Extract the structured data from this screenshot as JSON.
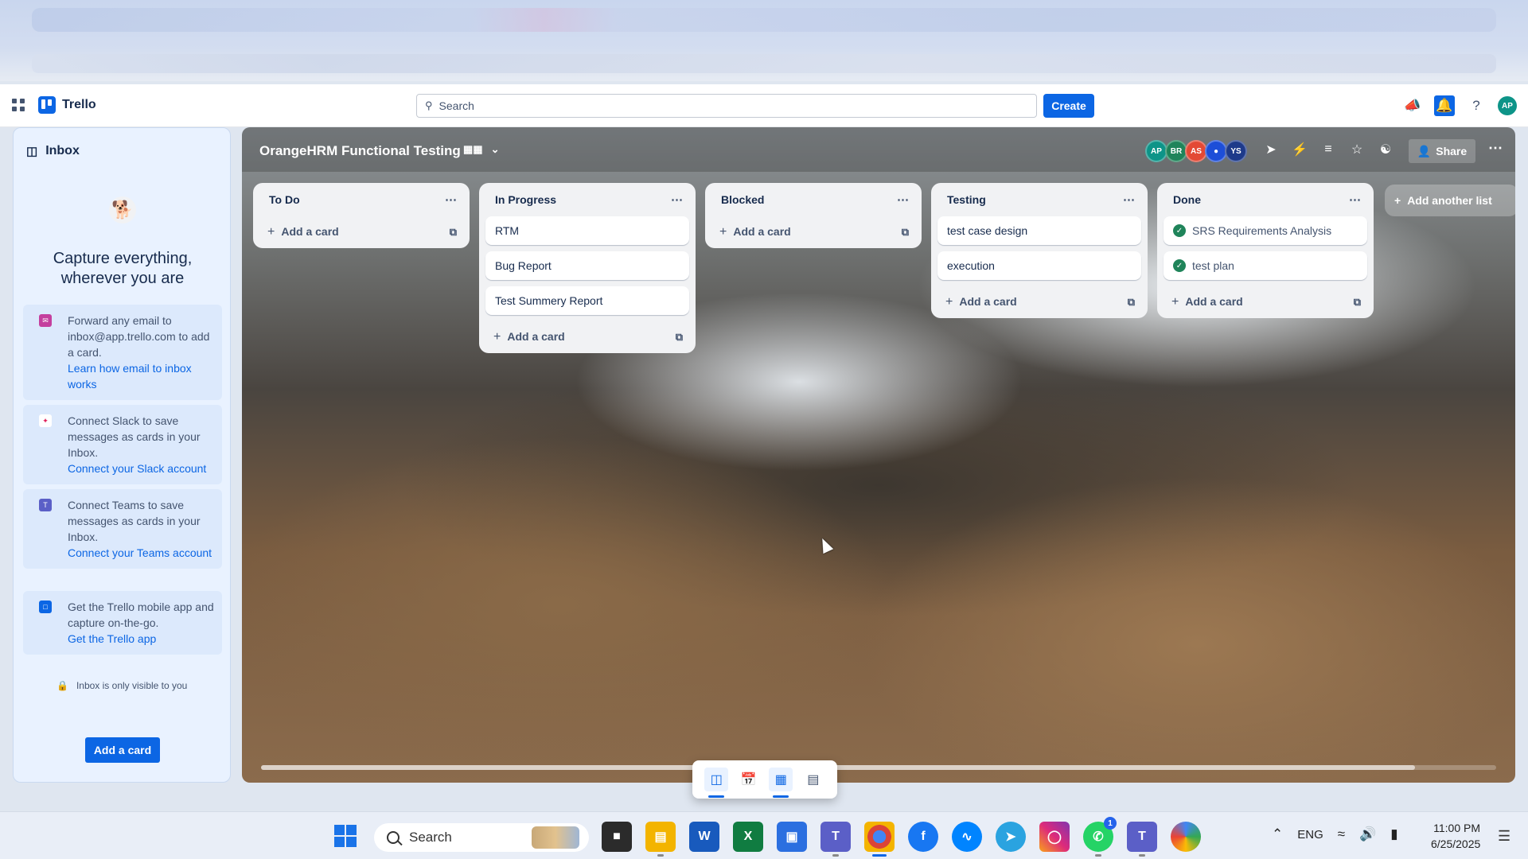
{
  "header": {
    "app_name": "Trello",
    "search_placeholder": "Search",
    "create_label": "Create",
    "user_initials": "AP",
    "colors": {
      "accent": "#0c66e4",
      "avatar": "#0d9488"
    }
  },
  "inbox": {
    "title": "Inbox",
    "headline_1": "Capture everything,",
    "headline_2": "wherever you are",
    "tips": [
      {
        "text": "Forward any email to inbox@app.trello.com to add a card.",
        "link": "Learn how email to inbox works",
        "icon": "email-icon"
      },
      {
        "text": "Connect Slack to save messages as cards in your Inbox.",
        "link": "Connect your Slack account",
        "icon": "slack-icon"
      },
      {
        "text": "Connect Teams to save messages as cards in your Inbox.",
        "link": "Connect your Teams account",
        "icon": "teams-icon"
      },
      {
        "text": "Get the Trello mobile app and capture on-the-go.",
        "link": "Get the Trello app",
        "icon": "mobile-icon"
      }
    ],
    "privacy_note": "Inbox is only visible to you",
    "add_card_label": "Add a card"
  },
  "board": {
    "title": "OrangeHRM Functional Testing",
    "members": [
      {
        "initials": "AP",
        "color": "#0d9488"
      },
      {
        "initials": "BR",
        "color": "#1f845a"
      },
      {
        "initials": "AS",
        "color": "#e34935"
      },
      {
        "initials": "",
        "color": "#1d4ed8"
      },
      {
        "initials": "YS",
        "color": "#1e3a8a"
      }
    ],
    "share_label": "Share",
    "add_list_label": "Add another list",
    "lists": [
      {
        "title": "To Do",
        "cards": [],
        "add_label": "Add a card"
      },
      {
        "title": "In Progress",
        "cards": [
          {
            "title": "RTM",
            "done": false
          },
          {
            "title": "Bug Report",
            "done": false
          },
          {
            "title": "Test Summery Report",
            "done": false
          }
        ],
        "add_label": "Add a card"
      },
      {
        "title": "Blocked",
        "cards": [],
        "add_label": "Add a card"
      },
      {
        "title": "Testing",
        "cards": [
          {
            "title": "test case design",
            "done": false
          },
          {
            "title": "execution",
            "done": false
          }
        ],
        "add_label": "Add a card"
      },
      {
        "title": "Done",
        "cards": [
          {
            "title": "SRS Requirements Analysis",
            "done": true
          },
          {
            "title": "test plan",
            "done": true
          }
        ],
        "add_label": "Add a card"
      }
    ]
  },
  "taskbar": {
    "search_label": "Search",
    "language": "ENG",
    "time": "11:00 PM",
    "date": "6/25/2025",
    "whatsapp_badge": "1"
  }
}
